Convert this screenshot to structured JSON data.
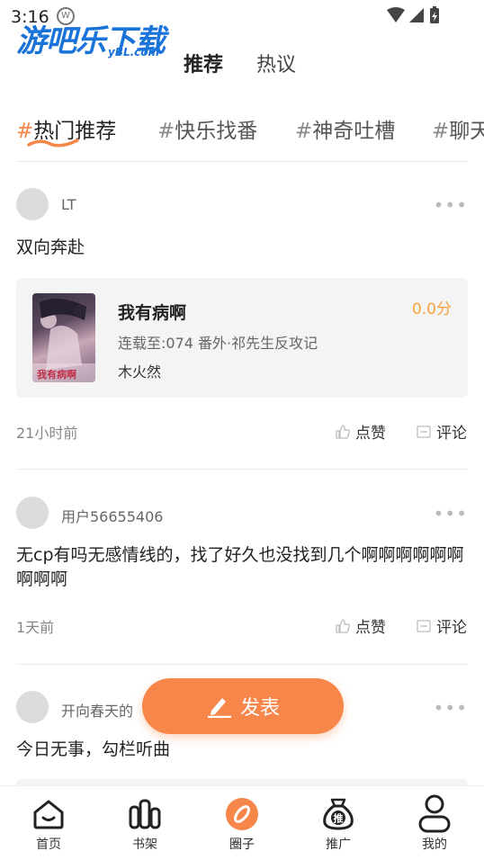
{
  "status_bar": {
    "time": "3:16"
  },
  "watermark": {
    "text": "游吧乐下载",
    "sub": "yBL.com"
  },
  "top_tabs": [
    {
      "label": "推荐",
      "active": true
    },
    {
      "label": "热议",
      "active": false
    }
  ],
  "topics": [
    {
      "hash": "#",
      "label": "热门推荐",
      "active": true
    },
    {
      "hash": "#",
      "label": "快乐找番",
      "active": false
    },
    {
      "hash": "#",
      "label": "神奇吐槽",
      "active": false
    },
    {
      "hash": "#",
      "label": "聊天",
      "active": false
    }
  ],
  "posts": [
    {
      "username": "LT",
      "content": "双向奔赴",
      "book": {
        "title": "我有病啊",
        "score": "0.0分",
        "update": "连载至:074 番外·祁先生反攻记",
        "author": "木火然",
        "cover_text": "我有病啊"
      },
      "time": "21小时前",
      "like_label": "点赞",
      "comment_label": "评论"
    },
    {
      "username": "用户56655406",
      "content": "无cp有吗无感情线的，找了好久也没找到几个啊啊啊啊啊啊啊啊啊",
      "time": "1天前",
      "like_label": "点赞",
      "comment_label": "评论"
    },
    {
      "username": "开向春天的",
      "content": "今日无事，勾栏听曲"
    }
  ],
  "more_glyph": "•••",
  "fab": {
    "label": "发表"
  },
  "bottom_nav": [
    {
      "label": "首页",
      "icon": "home-icon"
    },
    {
      "label": "书架",
      "icon": "bookshelf-icon"
    },
    {
      "label": "圈子",
      "icon": "circle-compass-icon",
      "active": true
    },
    {
      "label": "推广",
      "icon": "promote-bag-icon",
      "badge_char": "推"
    },
    {
      "label": "我的",
      "icon": "profile-icon"
    }
  ],
  "colors": {
    "accent": "#f7864a",
    "score": "#f7a23a"
  }
}
